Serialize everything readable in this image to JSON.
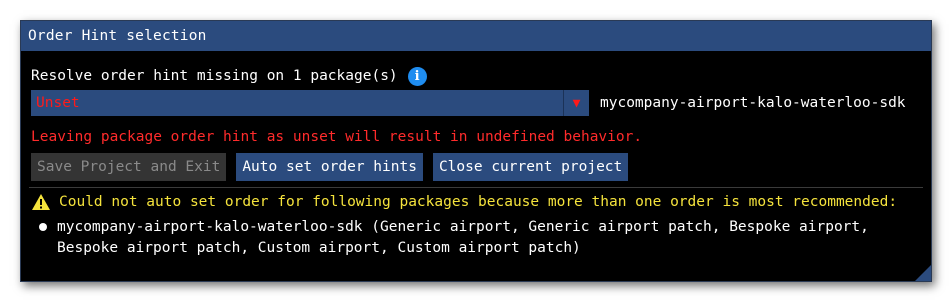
{
  "window": {
    "title": "Order Hint selection"
  },
  "resolve": {
    "text": "Resolve order hint missing on 1 package(s)",
    "info_icon": "info-icon"
  },
  "order_select": {
    "value": "Unset",
    "arrow_icon": "triangle-down-icon",
    "package_name": "mycompany-airport-kalo-waterloo-sdk"
  },
  "warning_unset": "Leaving package order hint as unset will result in undefined behavior.",
  "buttons": {
    "save_exit": "Save Project and Exit",
    "auto_set": "Auto set order hints",
    "close_project": "Close current project"
  },
  "auto_warning": {
    "icon": "warning-icon",
    "text": "Could not auto set order for following packages because more than one order is most recommended:"
  },
  "packages": [
    {
      "text": "mycompany-airport-kalo-waterloo-sdk (Generic airport, Generic airport patch, Bespoke airport, Bespoke airport patch, Custom airport, Custom airport patch)"
    }
  ],
  "colors": {
    "accent": "#2b4b7e",
    "error": "#ff2b2b",
    "warning": "#f5e33c",
    "info": "#1f8df0",
    "background": "#000000"
  }
}
